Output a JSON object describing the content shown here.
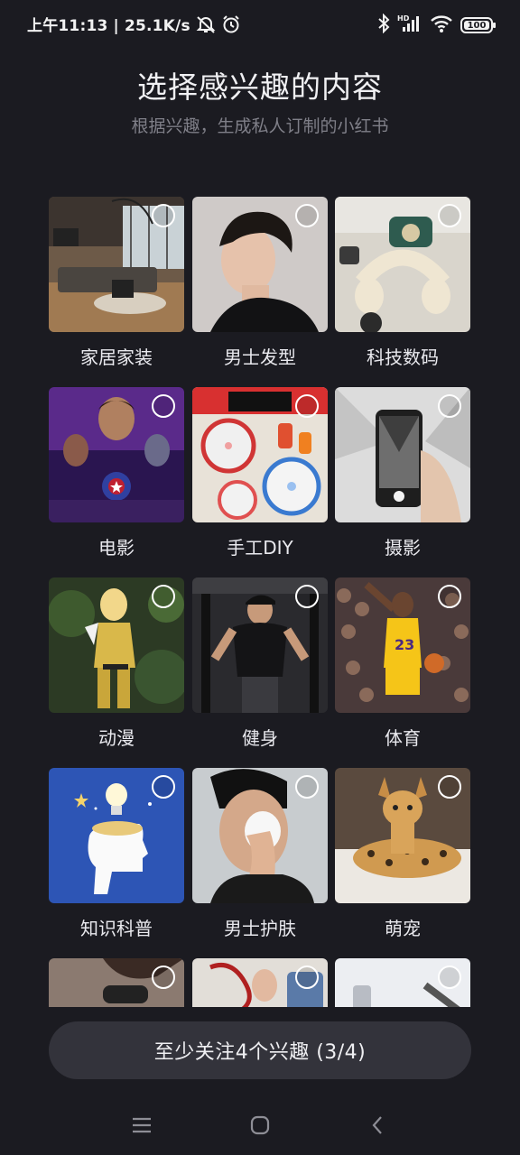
{
  "status_bar": {
    "time": "上午11:13",
    "network_speed": "25.1K/s",
    "battery_level": "100",
    "icons": [
      "mute-icon",
      "alarm-icon",
      "bluetooth-icon",
      "hd-signal-icon",
      "wifi-icon",
      "battery-icon"
    ]
  },
  "header": {
    "title": "选择感兴趣的内容",
    "subtitle": "根据兴趣，生成私人订制的小红书"
  },
  "interests": [
    {
      "label": "家居家装",
      "selected": false
    },
    {
      "label": "男士发型",
      "selected": false
    },
    {
      "label": "科技数码",
      "selected": false
    },
    {
      "label": "电影",
      "selected": false
    },
    {
      "label": "手工DIY",
      "selected": false
    },
    {
      "label": "摄影",
      "selected": false
    },
    {
      "label": "动漫",
      "selected": false
    },
    {
      "label": "健身",
      "selected": false
    },
    {
      "label": "体育",
      "selected": false
    },
    {
      "label": "知识科普",
      "selected": false
    },
    {
      "label": "男士护肤",
      "selected": false
    },
    {
      "label": "萌宠",
      "selected": false
    },
    {
      "label": "",
      "selected": false
    },
    {
      "label": "",
      "selected": false
    },
    {
      "label": "",
      "selected": false
    }
  ],
  "footer": {
    "follow_button": "至少关注4个兴趣 (3/4)"
  },
  "nav_bar": {
    "icons": [
      "menu-icon",
      "home-icon",
      "back-icon"
    ]
  },
  "colors": {
    "background": "#1b1b21",
    "button": "#33333b",
    "subtitle": "#7f7f88"
  }
}
